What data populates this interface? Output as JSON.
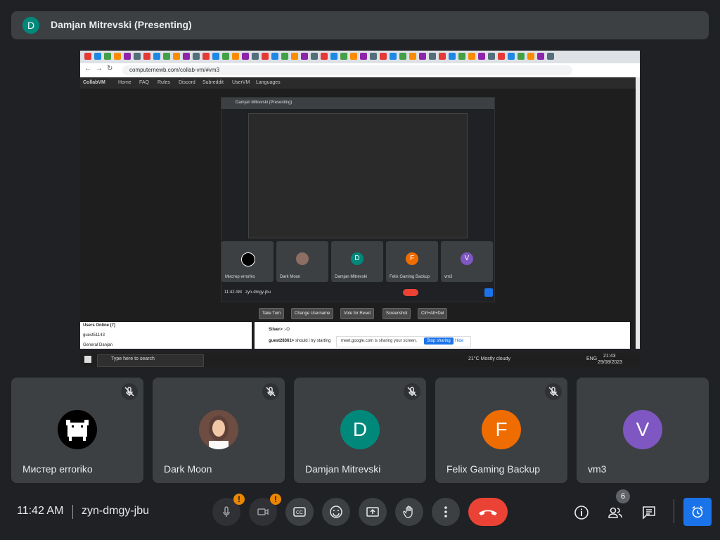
{
  "presenter": {
    "initial": "D",
    "name": "Damjan Mitrevski (Presenting)"
  },
  "shared_screen": {
    "browser": {
      "url": "computernewb.com/collab-vm/#vm3"
    },
    "collabvm": {
      "nav": [
        "CollabVM",
        "Home",
        "FAQ",
        "Rules",
        "Discord",
        "Subreddit",
        "UserVM",
        "Languages"
      ],
      "inner_presenter": "Damjan Mitrevski (Presenting)",
      "inner_tiles": [
        {
          "name": "Мистер erroriko",
          "initial": ""
        },
        {
          "name": "Dark Moon",
          "initial": ""
        },
        {
          "name": "Damjan Mitrevski",
          "initial": "D"
        },
        {
          "name": "Felix Gaming Backup",
          "initial": "F"
        },
        {
          "name": "vm3",
          "initial": "V"
        }
      ],
      "inner_time": "11:42 AM",
      "inner_code": "zyn-dmgy-jbu",
      "buttons": [
        "Take Turn",
        "Change Username",
        "Vote for Reset",
        "Screenshot",
        "Ctrl+Alt+Del"
      ],
      "users_online_title": "Users Online (7)",
      "users": [
        "guest51143",
        "General Danjan"
      ],
      "chat": [
        {
          "user": "Silver>",
          "text": ":-O"
        },
        {
          "user": "guest28361>",
          "text": "should i try starting"
        }
      ],
      "share_notice": "meet.google.com is sharing your screen.",
      "stop_sharing": "Stop sharing",
      "hide": "Hide"
    },
    "taskbar": {
      "search_placeholder": "Type here to search",
      "weather": "21°C  Mostly cloudy",
      "lang": "ENG",
      "time": "21:43",
      "date": "29/08/2023"
    }
  },
  "participants": [
    {
      "name": "Мистер erroriko",
      "initial": "",
      "color": "#000000"
    },
    {
      "name": "Dark Moon",
      "initial": "",
      "color": "#8d6e63"
    },
    {
      "name": "Damjan Mitrevski",
      "initial": "D",
      "color": "#00897b"
    },
    {
      "name": "Felix Gaming Backup",
      "initial": "F",
      "color": "#ef6c00"
    },
    {
      "name": "vm3",
      "initial": "V",
      "color": "#7e57c2"
    }
  ],
  "bottom": {
    "time": "11:42 AM",
    "meeting_code": "zyn-dmgy-jbu",
    "warning_mark": "!",
    "participants_count": "6"
  },
  "colors": {
    "background": "#202124",
    "tile": "#3c4043",
    "end_call": "#ea4335",
    "accent": "#1a73e8",
    "warning": "#ea8600"
  }
}
